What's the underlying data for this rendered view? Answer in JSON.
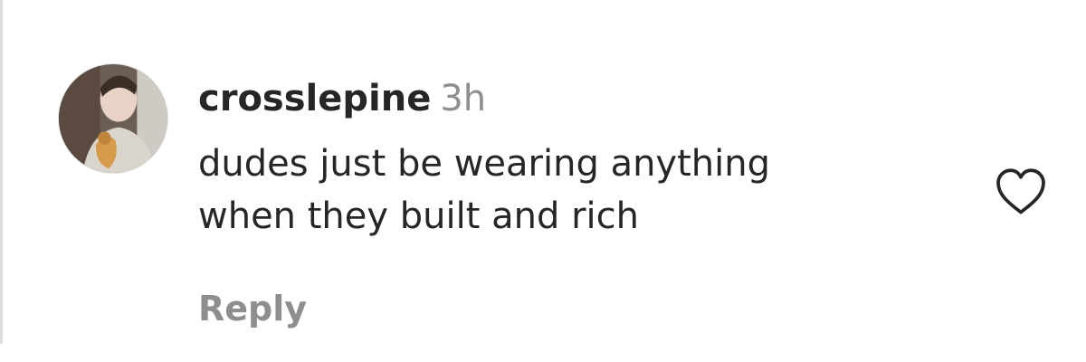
{
  "comment": {
    "username": "crosslepine",
    "timestamp": "3h",
    "text_lines": [
      "dudes just be wearing anything",
      "when they built and rich"
    ],
    "reply_label": "Reply",
    "like_icon": "heart-outline-icon",
    "avatar_icon": "user-avatar",
    "colors": {
      "text": "#262626",
      "muted": "#8e8e8e",
      "border": "#dbdbdb"
    }
  }
}
